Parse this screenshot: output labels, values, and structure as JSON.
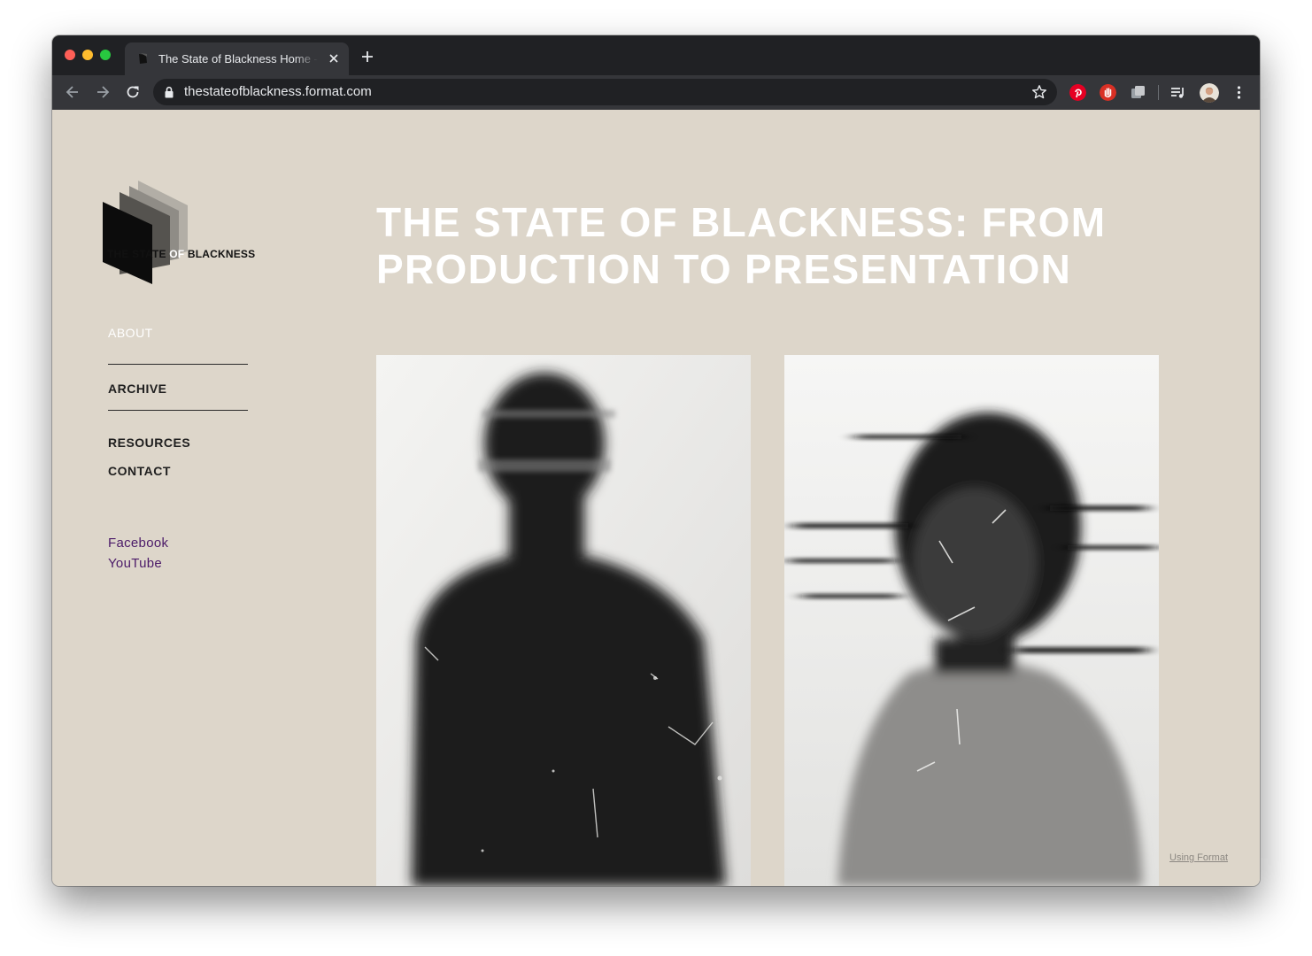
{
  "browser": {
    "tab_title": "The State of Blackness Home - Format",
    "url": "thestateofblackness.format.com"
  },
  "site": {
    "logo": {
      "text_black": "THE STATE ",
      "text_white": "OF",
      "text_black2": " BLACKNESS"
    },
    "nav": {
      "about": "ABOUT",
      "archive": "ARCHIVE",
      "resources": "RESOURCES",
      "contact": "CONTACT"
    },
    "social": {
      "facebook": "Facebook",
      "youtube": "YouTube"
    },
    "headline_line1": "THE STATE OF BLACKNESS: FROM",
    "headline_line2": "PRODUCTION TO PRESENTATION",
    "footer_link": "Using Format"
  },
  "colors": {
    "page_bg": "#ddd6ca",
    "headline": "#ffffff",
    "social_link": "#4b1a68",
    "chrome_dark": "#202124",
    "chrome_toolbar": "#35363a"
  },
  "icons": [
    "back-arrow-icon",
    "forward-arrow-icon",
    "reload-icon",
    "lock-icon",
    "bookmark-star-icon",
    "pinterest-icon",
    "hand-stop-icon",
    "extension-icon",
    "media-queue-icon",
    "profile-avatar-icon",
    "kebab-menu-icon"
  ]
}
